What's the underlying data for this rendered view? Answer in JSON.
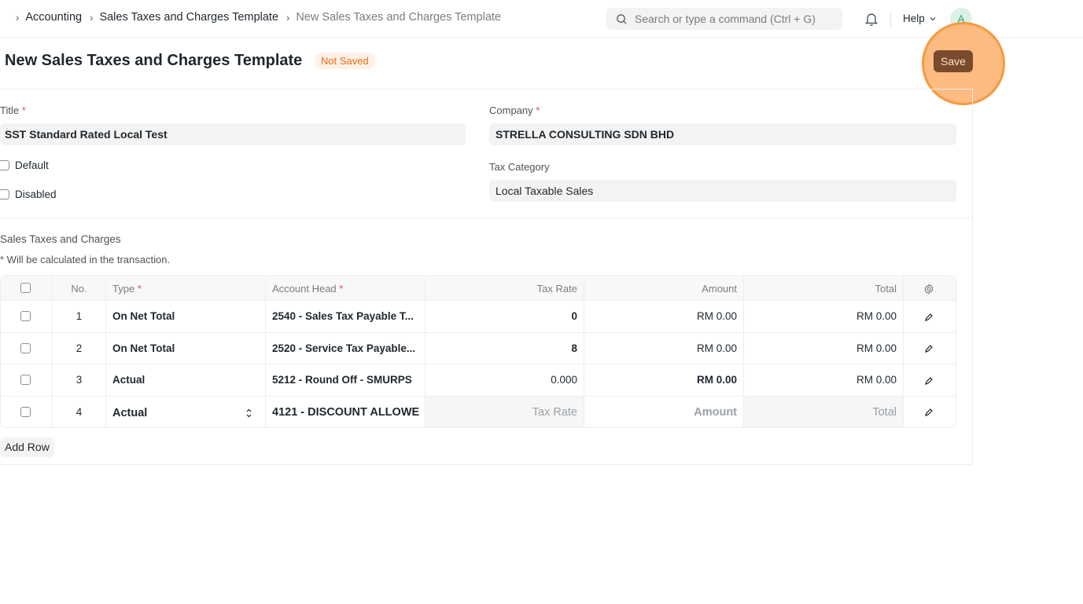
{
  "navbar": {
    "breadcrumbs": [
      "Accounting",
      "Sales Taxes and Charges Template",
      "New Sales Taxes and Charges Template"
    ],
    "search_placeholder": "Search or type a command (Ctrl + G)",
    "help_label": "Help",
    "avatar_initial": "A"
  },
  "page": {
    "title": "New Sales Taxes and Charges Template",
    "status_badge": "Not Saved",
    "save_label": "Save"
  },
  "form": {
    "title_label": "Title",
    "title_value": "SST Standard Rated Local Test",
    "company_label": "Company",
    "company_value": "STRELLA CONSULTING SDN BHD",
    "default_label": "Default",
    "disabled_label": "Disabled",
    "tax_category_label": "Tax Category",
    "tax_category_value": "Local Taxable Sales",
    "required_mark": "*"
  },
  "taxes_section": {
    "title": "Sales Taxes and Charges",
    "description": "* Will be calculated in the transaction.",
    "columns": {
      "no": "No.",
      "type": "Type",
      "account_head": "Account Head",
      "tax_rate": "Tax Rate",
      "amount": "Amount",
      "total": "Total"
    },
    "rows": [
      {
        "no": "1",
        "type": "On Net Total",
        "account_head": "2540 - Sales Tax Payable T...",
        "tax_rate": "0",
        "amount": "RM 0.00",
        "total": "RM 0.00"
      },
      {
        "no": "2",
        "type": "On Net Total",
        "account_head": "2520 - Service Tax Payable...",
        "tax_rate": "8",
        "amount": "RM 0.00",
        "total": "RM 0.00"
      },
      {
        "no": "3",
        "type": "Actual",
        "account_head": "5212 - Round Off - SMURPS",
        "tax_rate": "0.000",
        "amount": "RM 0.00",
        "total": "RM 0.00"
      },
      {
        "no": "4",
        "type": "Actual",
        "account_head": "4121 - DISCOUNT ALLOWE",
        "tax_rate_placeholder": "Tax Rate",
        "amount_placeholder": "Amount",
        "total_placeholder": "Total"
      }
    ],
    "add_row_label": "Add Row"
  },
  "icons": {
    "crumb_separator": "chevron-right-icon",
    "search": "search-icon",
    "notifications": "bell-icon",
    "help_dropdown": "chevron-down-icon",
    "grid_settings": "gear-icon",
    "row_edit": "pencil-icon",
    "select_sort": "up-down-chevron-icon"
  },
  "colors": {
    "save_button": "#7a4a2c",
    "highlight": "#f59a3f",
    "badge_text": "#e86c13",
    "required": "#e24c4c"
  }
}
